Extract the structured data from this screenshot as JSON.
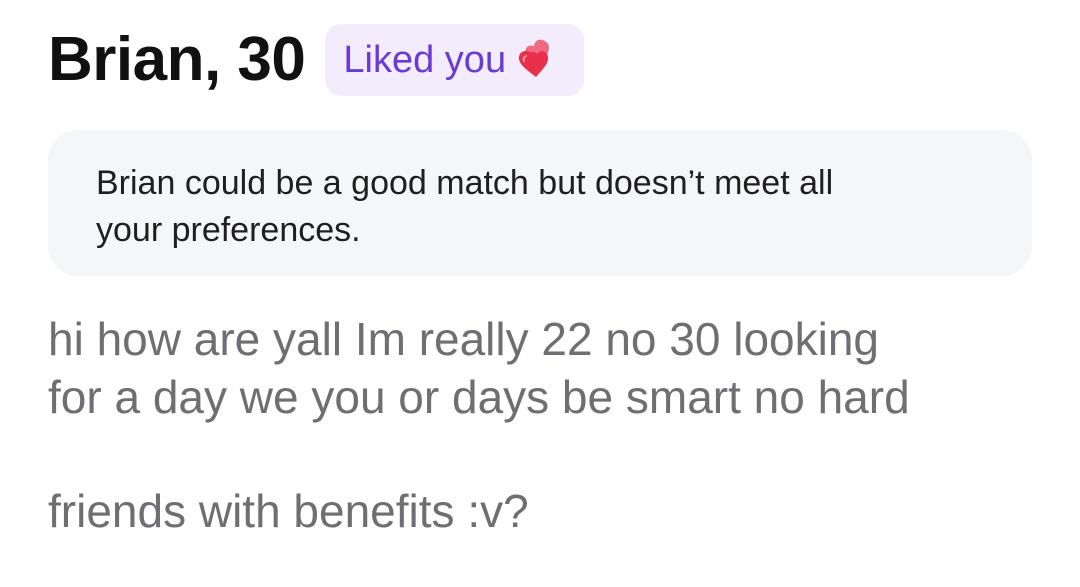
{
  "profile": {
    "name_age": "Brian, 30",
    "badge": {
      "label": "Liked you",
      "icon": "two-hearts-icon"
    }
  },
  "notice": {
    "text_line1": "Brian could be a good match but doesn’t meet all",
    "text_line2": "your preferences."
  },
  "bio": {
    "line1": "hi how are yall Im really 22 no 30 looking",
    "line2": "for a day we you or days be smart no hard",
    "line3": "friends with benefits :v?"
  },
  "colors": {
    "badge_bg": "#f2ecfd",
    "badge_text": "#6a3bd3",
    "notice_bg": "#f5f6f8",
    "bio_text": "#6e6e73",
    "heart": "#e8304a"
  }
}
